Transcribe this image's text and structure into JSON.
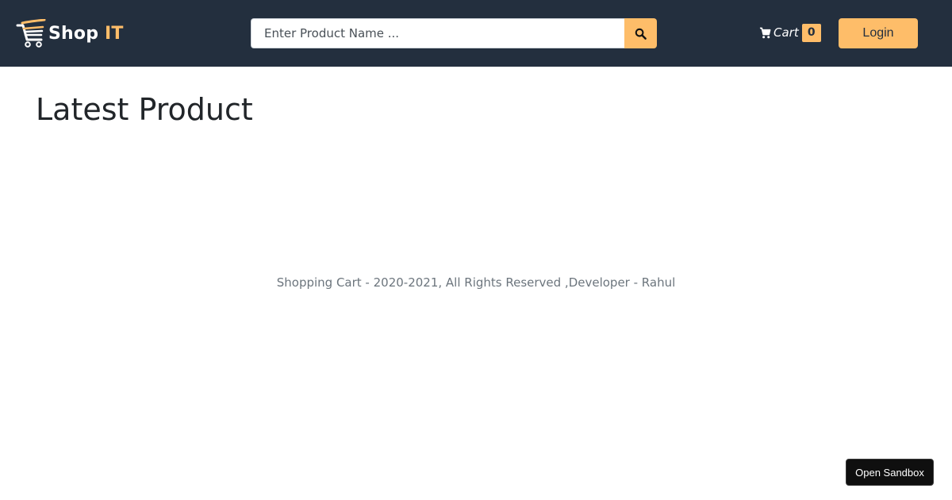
{
  "header": {
    "brand": {
      "name_main": "Shop",
      "name_accent": "IT",
      "icon": "shopping-cart-icon"
    },
    "search": {
      "placeholder": "Enter Product Name ...",
      "value": "",
      "button_icon": "search-icon"
    },
    "cart": {
      "icon": "cart-icon",
      "label": "Cart",
      "count": "0"
    },
    "login_label": "Login"
  },
  "main": {
    "heading": "Latest Product"
  },
  "footer": {
    "text": "Shopping Cart - 2020-2021, All Rights Reserved ,Developer - Rahul"
  },
  "sandbox": {
    "label": "Open Sandbox"
  },
  "colors": {
    "navbar_bg": "#232f3e",
    "accent": "#febd69",
    "footer_text": "#6c757d"
  }
}
